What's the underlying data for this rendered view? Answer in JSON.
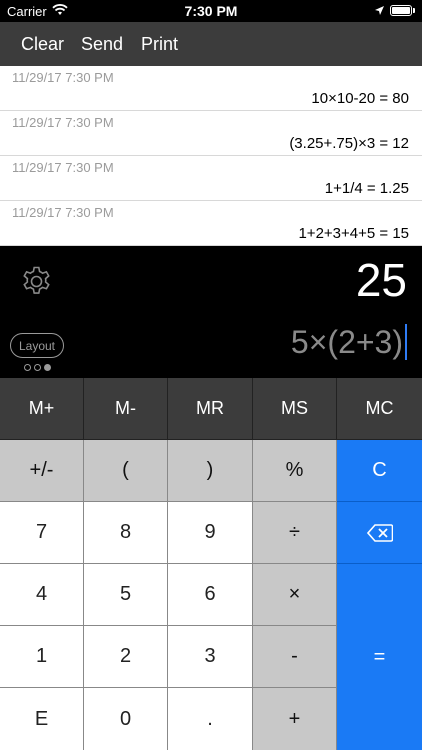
{
  "status_bar": {
    "carrier": "Carrier",
    "time": "7:30 PM"
  },
  "toolbar": {
    "clear": "Clear",
    "send": "Send",
    "print": "Print"
  },
  "history": [
    {
      "timestamp": "11/29/17 7:30 PM",
      "expression": "10×10-20 = 80"
    },
    {
      "timestamp": "11/29/17 7:30 PM",
      "expression": "(3.25+.75)×3 = 12"
    },
    {
      "timestamp": "11/29/17 7:30 PM",
      "expression": "1+1/4 = 1.25"
    },
    {
      "timestamp": "11/29/17 7:30 PM",
      "expression": "1+2+3+4+5 = 15"
    }
  ],
  "display": {
    "result": "25",
    "expression": "5×(2+3)",
    "layout_label": "Layout"
  },
  "keys": {
    "m_plus": "M+",
    "m_minus": "M-",
    "mr": "MR",
    "ms": "MS",
    "mc": "MC",
    "plus_minus": "+/-",
    "lparen": "(",
    "rparen": ")",
    "percent": "%",
    "clear": "C",
    "seven": "7",
    "eight": "8",
    "nine": "9",
    "divide": "÷",
    "backspace": "⌫",
    "four": "4",
    "five": "5",
    "six": "6",
    "multiply": "×",
    "one": "1",
    "two": "2",
    "three": "3",
    "minus": "-",
    "equals": "=",
    "e": "E",
    "zero": "0",
    "dot": ".",
    "plus": "+"
  },
  "colors": {
    "accent": "#1a7af5",
    "memory_row": "#3c3c3c",
    "operator_keys": "#c8c8c8",
    "digit_keys": "#ffffff"
  }
}
